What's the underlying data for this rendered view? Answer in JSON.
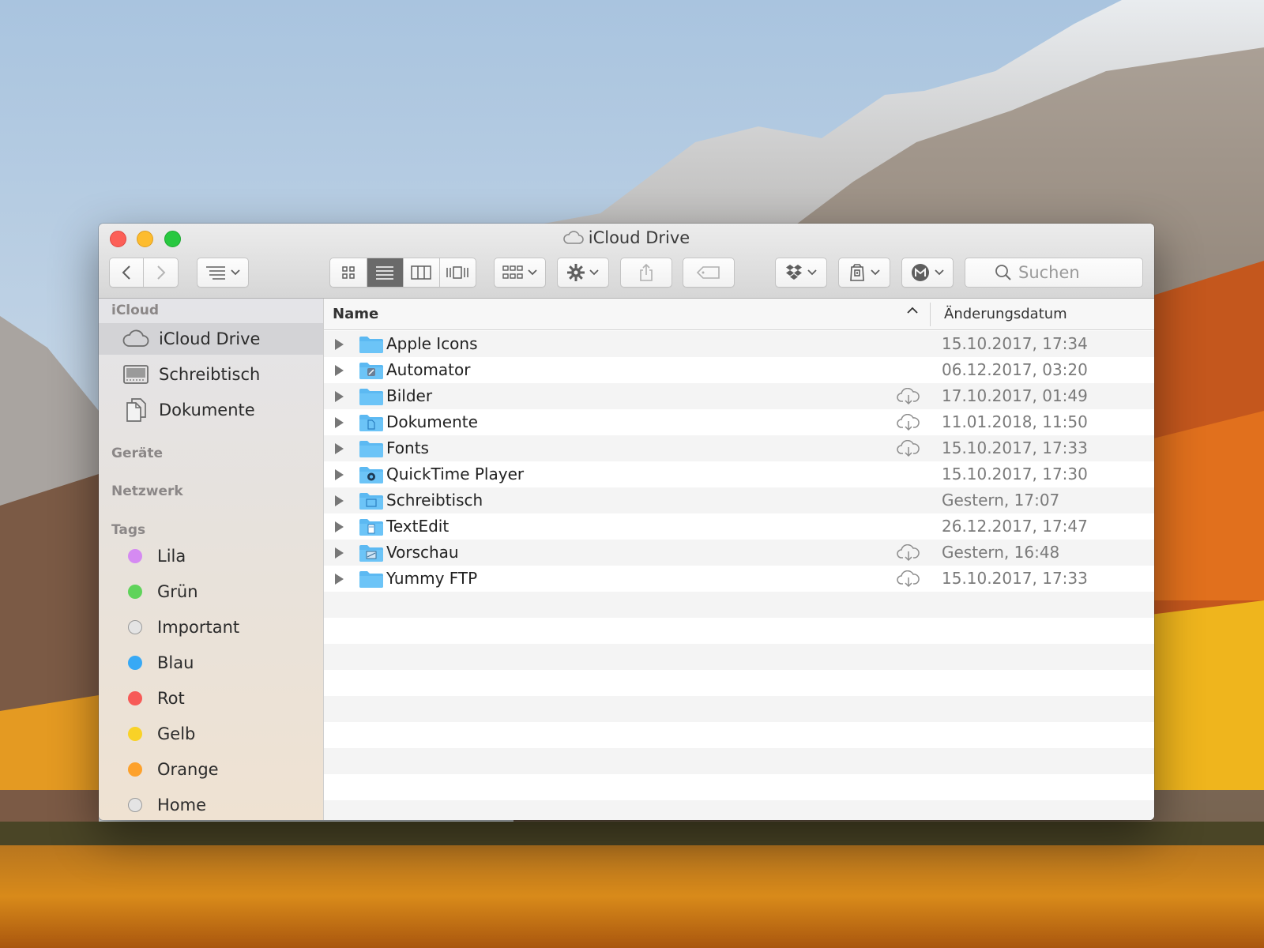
{
  "window": {
    "title": "iCloud Drive",
    "search_placeholder": "Suchen"
  },
  "sidebar": {
    "sections": {
      "icloud": "iCloud",
      "devices": "Geräte",
      "network": "Netzwerk",
      "tags": "Tags"
    },
    "icloud_items": [
      {
        "label": "iCloud Drive",
        "icon": "cloud-icon",
        "selected": true
      },
      {
        "label": "Schreibtisch",
        "icon": "desktop-icon",
        "selected": false
      },
      {
        "label": "Dokumente",
        "icon": "documents-icon",
        "selected": false
      }
    ],
    "tags": [
      {
        "label": "Lila",
        "color": "#d58af2"
      },
      {
        "label": "Grün",
        "color": "#5fd35a"
      },
      {
        "label": "Important",
        "color": "#e4e4e4"
      },
      {
        "label": "Blau",
        "color": "#38a9f5"
      },
      {
        "label": "Rot",
        "color": "#f75a57"
      },
      {
        "label": "Gelb",
        "color": "#f9d227"
      },
      {
        "label": "Orange",
        "color": "#fda12b"
      },
      {
        "label": "Home",
        "color": "#e4e4e4"
      }
    ]
  },
  "columns": {
    "name": "Name",
    "date": "Änderungsdatum"
  },
  "files": [
    {
      "name": "Apple Icons",
      "date": "15.10.2017, 17:34",
      "cloud": false,
      "badge": "none"
    },
    {
      "name": "Automator",
      "date": "06.12.2017, 03:20",
      "cloud": false,
      "badge": "automator"
    },
    {
      "name": "Bilder",
      "date": "17.10.2017, 01:49",
      "cloud": true,
      "badge": "none"
    },
    {
      "name": "Dokumente",
      "date": "11.01.2018, 11:50",
      "cloud": true,
      "badge": "doc"
    },
    {
      "name": "Fonts",
      "date": "15.10.2017, 17:33",
      "cloud": true,
      "badge": "none"
    },
    {
      "name": "QuickTime Player",
      "date": "15.10.2017, 17:30",
      "cloud": false,
      "badge": "quicktime"
    },
    {
      "name": "Schreibtisch",
      "date": "Gestern, 17:07",
      "cloud": false,
      "badge": "desktop"
    },
    {
      "name": "TextEdit",
      "date": "26.12.2017, 17:47",
      "cloud": false,
      "badge": "textedit"
    },
    {
      "name": "Vorschau",
      "date": "Gestern, 16:48",
      "cloud": true,
      "badge": "preview"
    },
    {
      "name": "Yummy FTP",
      "date": "15.10.2017, 17:33",
      "cloud": true,
      "badge": "none"
    }
  ],
  "colors": {
    "selection": "#d3d3d6",
    "folder": "#5cb9f2",
    "active_segment": "#6a6a6a"
  }
}
